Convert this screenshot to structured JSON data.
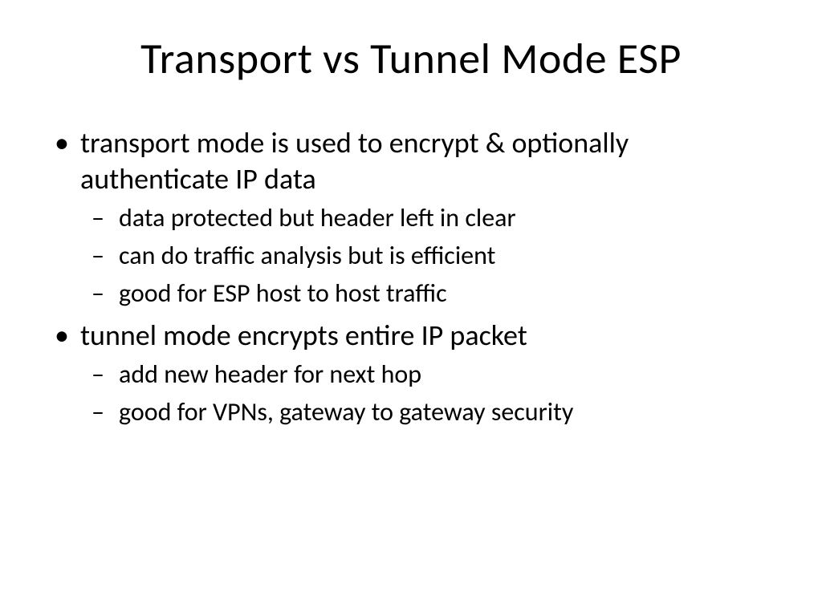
{
  "title": "Transport vs Tunnel Mode ESP",
  "bullets": [
    {
      "text": "transport mode is used to encrypt & optionally authenticate IP data",
      "sub": [
        "data protected but header left in clear",
        "can do traffic analysis but is efficient",
        "good for ESP host to host traffic"
      ]
    },
    {
      "text": "tunnel mode encrypts entire IP packet",
      "sub": [
        "add new header for next hop",
        "good for VPNs, gateway to gateway security"
      ]
    }
  ]
}
